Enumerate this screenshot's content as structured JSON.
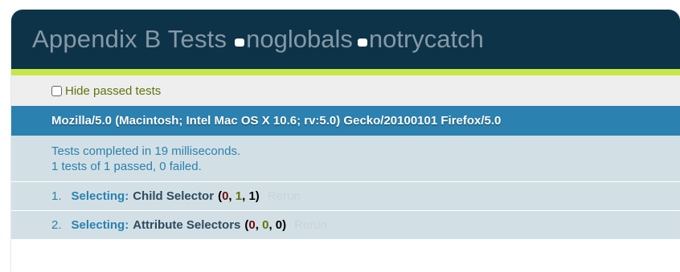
{
  "header": {
    "title": "Appendix B Tests",
    "options": [
      {
        "label": "noglobals"
      },
      {
        "label": "notrycatch"
      }
    ]
  },
  "toolbar": {
    "hide_passed_label": "Hide passed tests"
  },
  "user_agent": "Mozilla/5.0 (Macintosh; Intel Mac OS X 10.6; rv:5.0) Gecko/20100101 Firefox/5.0",
  "result": {
    "line1": "Tests completed in 19 milliseconds.",
    "line2": "1 tests of 1 passed, 0 failed."
  },
  "tests": [
    {
      "index": "1.",
      "module": "Selecting:",
      "name": "Child Selector",
      "failed": "0",
      "passed": "1",
      "total": "1",
      "rerun": "Rerun"
    },
    {
      "index": "2.",
      "module": "Selecting:",
      "name": "Attribute Selectors",
      "failed": "0",
      "passed": "0",
      "total": "0",
      "rerun": "Rerun"
    }
  ],
  "colors": {
    "banner_bg": "#0d3349",
    "accent": "#c6e746",
    "ua_bg": "#2b81af",
    "row_bg": "#d2e0e6",
    "fail": "#710909",
    "pass": "#5e740b"
  }
}
